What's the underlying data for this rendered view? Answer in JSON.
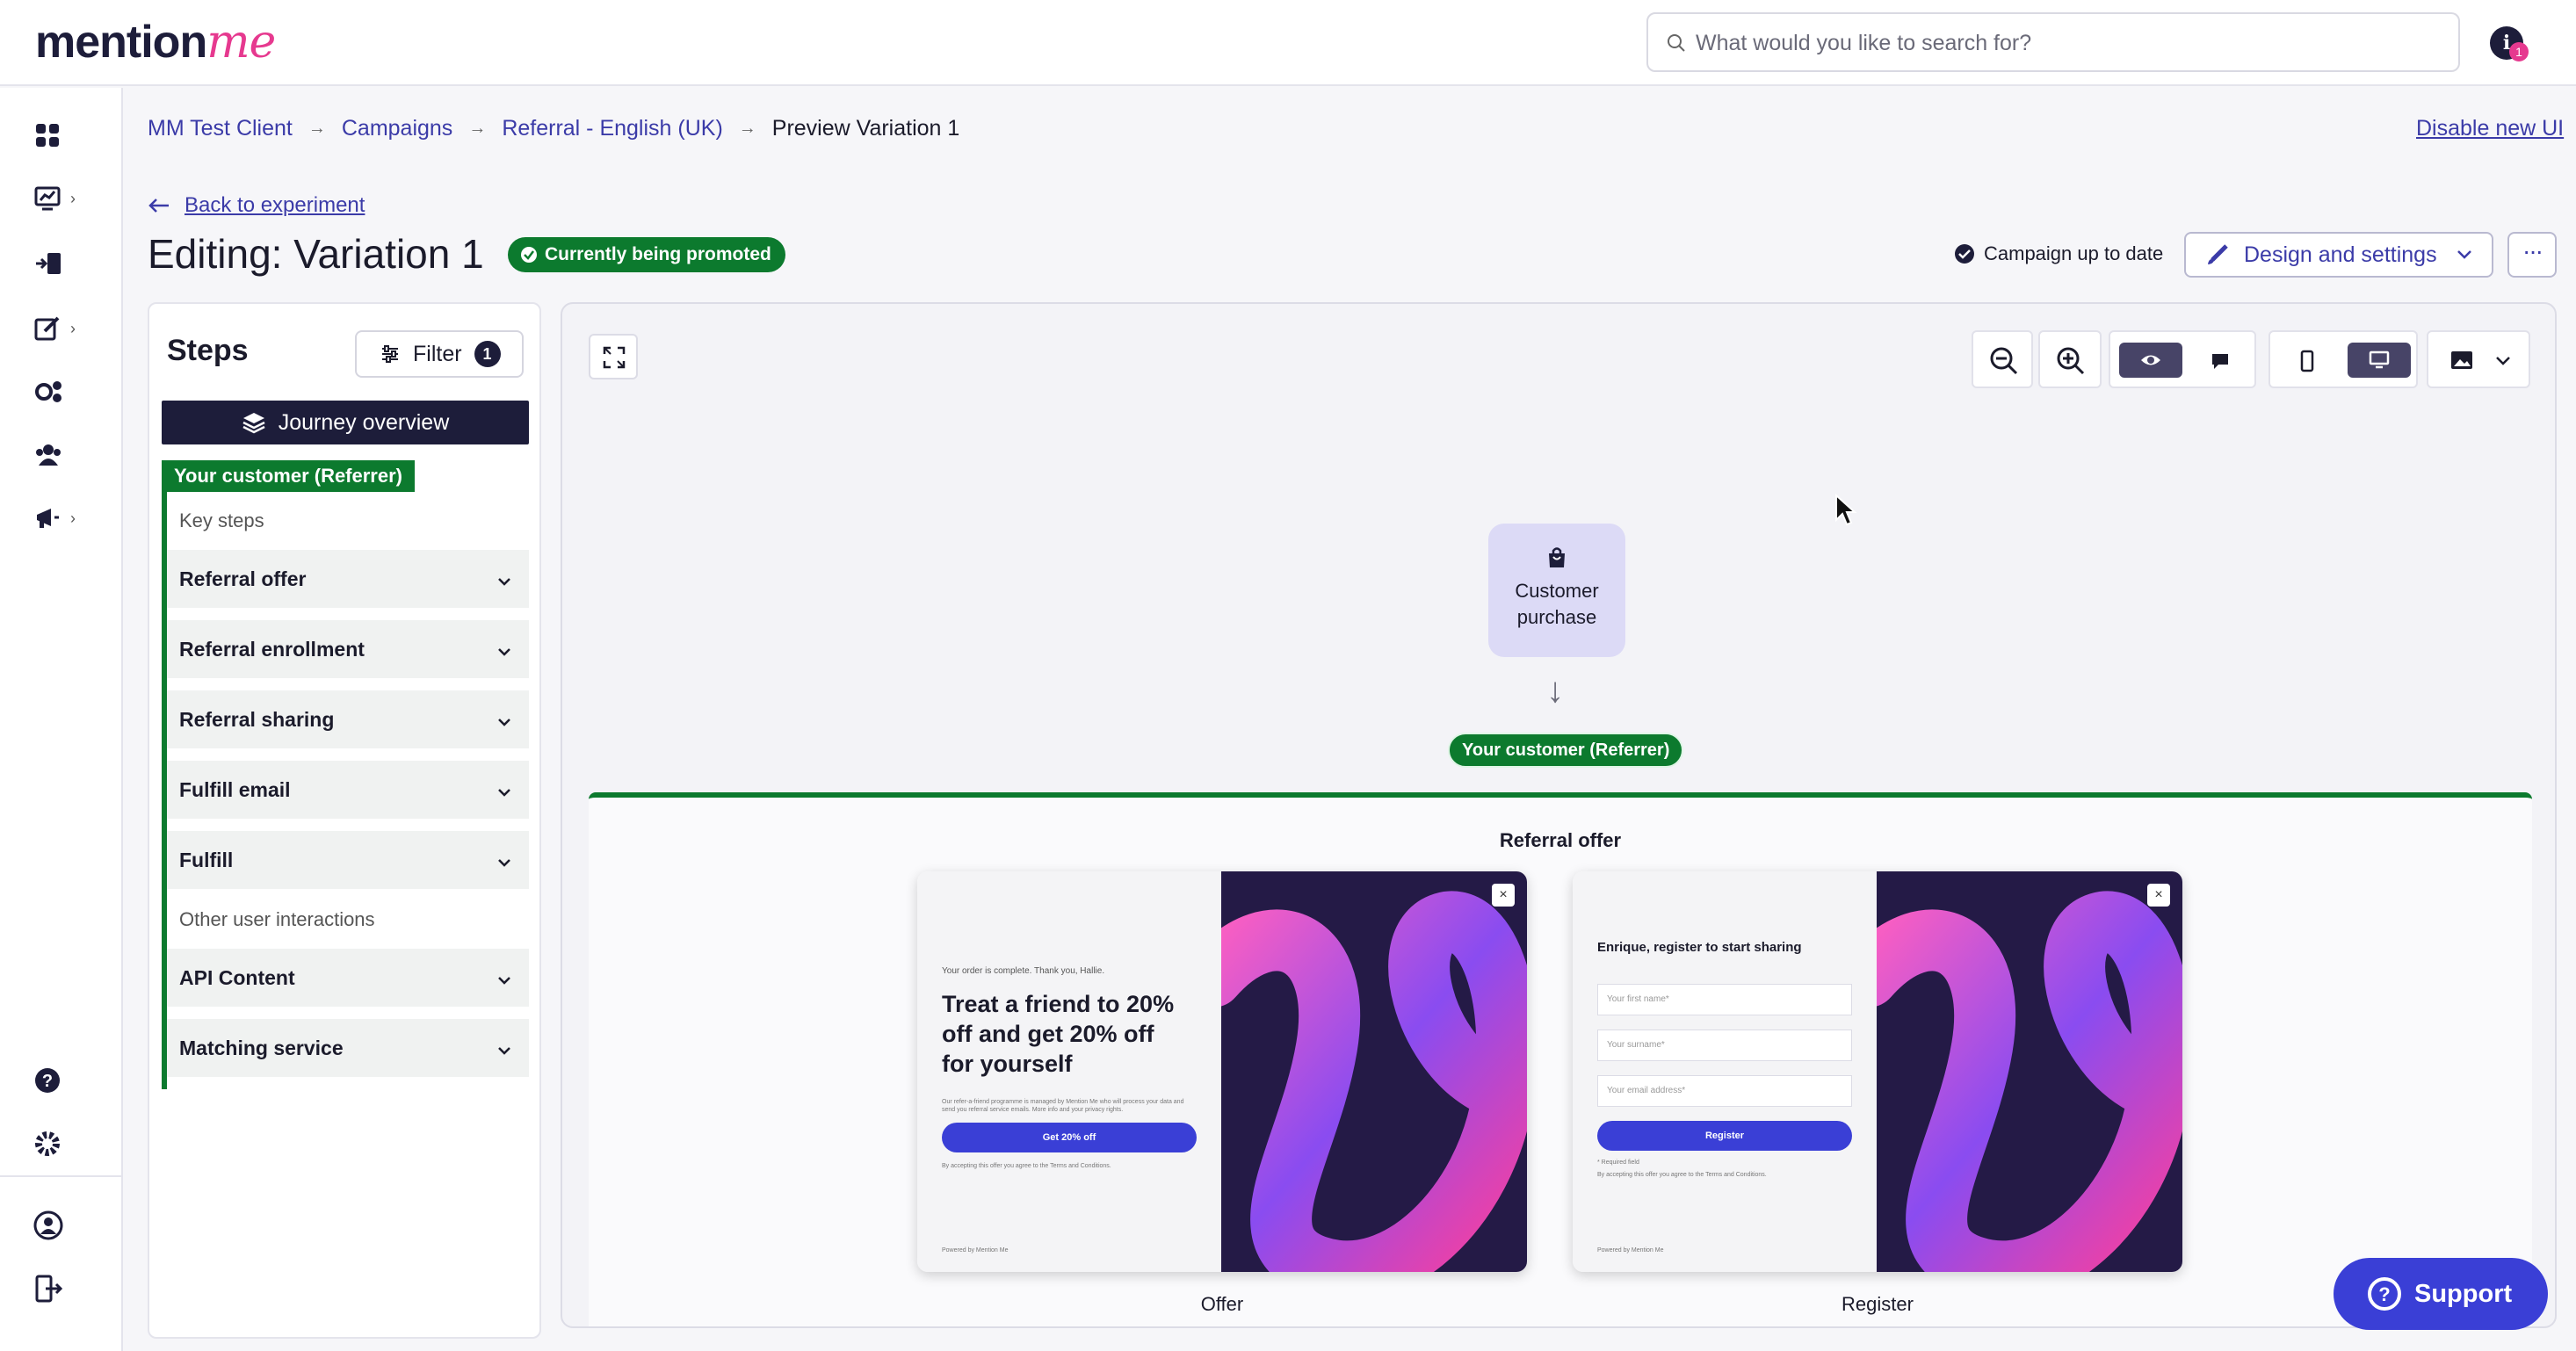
{
  "header": {
    "logo_text": "mention",
    "logo_accent": "me",
    "search_placeholder": "What would you like to search for?",
    "notification_count": "1"
  },
  "rail": {
    "icons": [
      "dashboard-icon",
      "reports-icon",
      "referrals-icon",
      "edit-icon",
      "settings-gears-icon",
      "users-icon",
      "campaign-megaphone-icon",
      "help-icon",
      "settings-icon",
      "account-icon",
      "logout-icon"
    ]
  },
  "breadcrumb": {
    "items": [
      "MM Test Client",
      "Campaigns",
      "Referral - English (UK)"
    ],
    "current": "Preview Variation 1"
  },
  "disable_new_ui": "Disable new UI",
  "back_link": "Back to experiment",
  "page_title": "Editing: Variation 1",
  "promo_badge": "Currently being promoted",
  "status": "Campaign up to date",
  "design_button": "Design and settings",
  "more_button": "···",
  "steps": {
    "title": "Steps",
    "filter_label": "Filter",
    "filter_count": "1",
    "journey_button": "Journey overview",
    "referrer_tag": "Your customer (Referrer)",
    "key_steps_label": "Key steps",
    "key_steps": [
      "Referral offer",
      "Referral enrollment",
      "Referral sharing",
      "Fulfill email",
      "Fulfill"
    ],
    "other_label": "Other user interactions",
    "other_steps": [
      "API Content",
      "Matching service"
    ]
  },
  "canvas": {
    "node_label_1": "Customer",
    "node_label_2": "purchase",
    "referrer_pill": "Your customer (Referrer)",
    "section_title": "Referral offer",
    "offer_card": {
      "intro": "Your order is complete. Thank you, Hallie.",
      "headline_1": "Treat a friend to 20%",
      "headline_2": "off and get 20% off",
      "headline_3": "for yourself",
      "fine_print": "Our refer-a-friend programme is managed by Mention Me who will process your data and send you referral service emails. More info and your privacy rights.",
      "button": "Get 20% off",
      "terms": "By accepting this offer you agree to the Terms and Conditions.",
      "powered": "Powered by Mention Me",
      "caption": "Offer"
    },
    "register_card": {
      "heading": "Enrique, register to start sharing",
      "first_name": "Your first name*",
      "surname": "Your surname*",
      "email": "Your email address*",
      "button": "Register",
      "required": "* Required field",
      "terms": "By accepting this offer you agree to the Terms and Conditions.",
      "powered": "Powered by Mention Me",
      "caption": "Register"
    }
  },
  "support_button": "Support",
  "colors": {
    "brand_navy": "#1d1d3a",
    "brand_pink": "#e6398f",
    "link_blue": "#3b3ba8",
    "promo_green": "#0c7a2e",
    "button_blue": "#3a3fd6"
  }
}
